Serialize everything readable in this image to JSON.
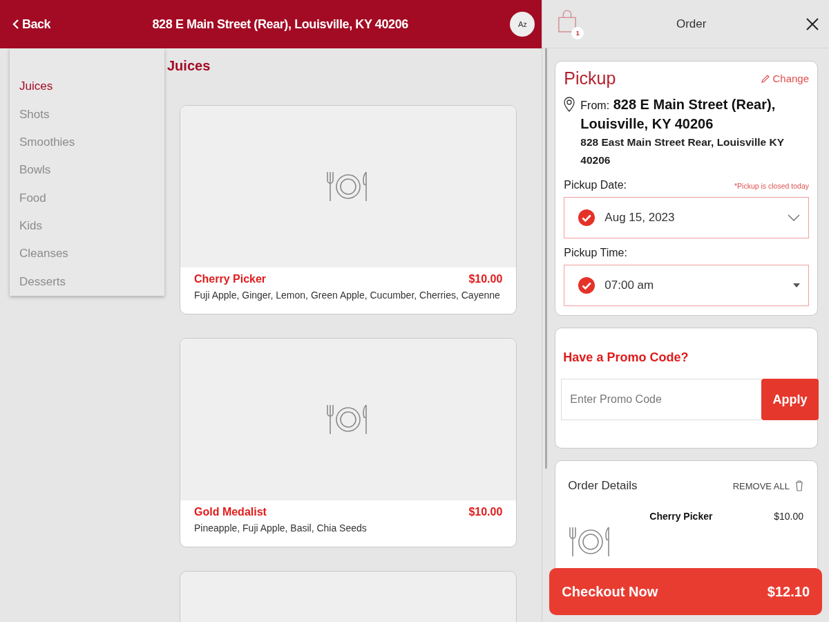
{
  "header": {
    "back_label": "Back",
    "title": "828 E Main Street (Rear), Louisville, KY 40206",
    "sort_label": "Az"
  },
  "categories": [
    {
      "label": "Juices",
      "selected": true
    },
    {
      "label": "Shots",
      "selected": false
    },
    {
      "label": "Smoothies",
      "selected": false
    },
    {
      "label": "Bowls",
      "selected": false
    },
    {
      "label": "Food",
      "selected": false
    },
    {
      "label": "Kids",
      "selected": false
    },
    {
      "label": "Cleanses",
      "selected": false
    },
    {
      "label": "Desserts",
      "selected": false
    }
  ],
  "section_title": "Juices",
  "products": [
    {
      "kind": "item",
      "name": "Cherry Picker",
      "price": "$10.00",
      "description": "Fuji Apple, Ginger, Lemon, Green Apple, Cucumber, Cherries, Cayenne"
    },
    {
      "kind": "item",
      "name": "Gold Medalist",
      "price": "$10.00",
      "description": "Pineapple, Fuji Apple, Basil, Chia Seeds"
    },
    {
      "kind": "partial"
    }
  ],
  "order_panel": {
    "title": "Order",
    "cart_count": "1",
    "pickup": {
      "title": "Pickup",
      "change_label": "Change",
      "from_label": "From:",
      "location_name": "828 E Main Street (Rear), Louisville, KY 40206",
      "address": "828 East Main Street Rear, Louisville KY 40206",
      "date_label": "Pickup Date:",
      "closed_note": "*Pickup is closed today",
      "date_value": "Aug 15, 2023",
      "time_label": "Pickup Time:",
      "time_value": "07:00 am"
    },
    "promo": {
      "title": "Have a Promo Code?",
      "placeholder": "Enter Promo Code",
      "button": "Apply"
    },
    "order_details": {
      "title": "Order Details",
      "remove_all": "REMOVE ALL",
      "items": [
        {
          "name": "Cherry Picker",
          "price": "$10.00"
        }
      ]
    },
    "checkout": {
      "label": "Checkout Now",
      "total": "$12.10"
    }
  }
}
